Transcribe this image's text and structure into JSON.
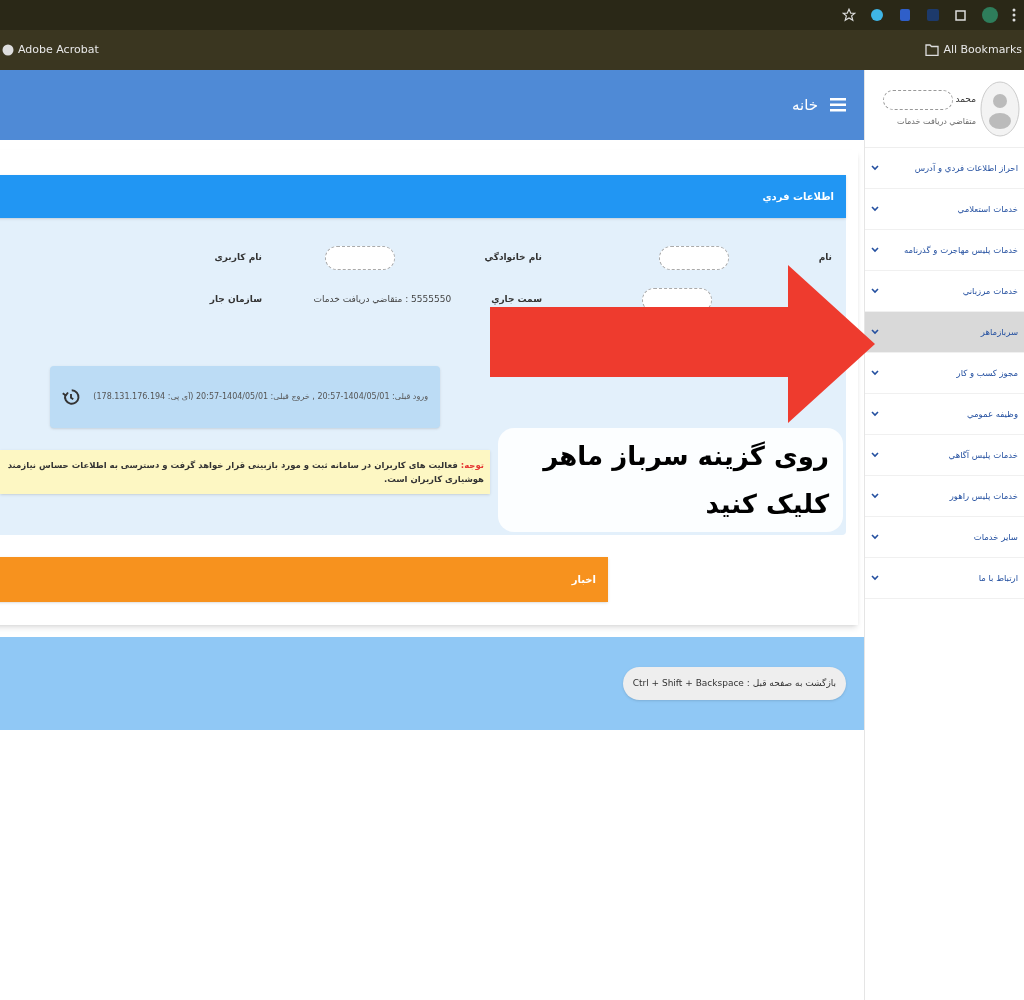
{
  "browser": {
    "bookmarks": [
      {
        "kind": "folder",
        "label": "All Bookmarks"
      },
      {
        "kind": "site",
        "label": "Adobe Acrobat"
      }
    ]
  },
  "header": {
    "title": "خانه"
  },
  "profile": {
    "name": "محمد",
    "name_redacted": true,
    "role": "متقاضي دريافت خدمات"
  },
  "sidebar": {
    "items": [
      {
        "label": "احراز اطلاعات فردي و آدرس",
        "selected": false
      },
      {
        "label": "خدمات استعلامي",
        "selected": false
      },
      {
        "label": "خدمات پليس مهاجرت و گذرنامه",
        "selected": false
      },
      {
        "label": "خدمات مرزباني",
        "selected": false
      },
      {
        "label": "سربازماهر",
        "selected": true
      },
      {
        "label": "مجوز كسب و كار",
        "selected": false
      },
      {
        "label": "وظيفه عمومي",
        "selected": false
      },
      {
        "label": "خدمات پليس آگاهي",
        "selected": false
      },
      {
        "label": "خدمات پليس راهور",
        "selected": false
      },
      {
        "label": "ساير خدمات",
        "selected": false
      },
      {
        "label": "ارتباط با ما",
        "selected": false
      }
    ]
  },
  "personal_info": {
    "title": "اطلاعات فردي",
    "rows": [
      [
        {
          "label": "نام",
          "redacted": true
        },
        {
          "label": "نام خانوادگي",
          "redacted": true
        },
        {
          "label": "نام کاربری"
        }
      ],
      [
        {
          "redacted": true
        },
        {
          "label": "سمت جاري",
          "value": "5555550 : متقاضي دريافت خدمات"
        },
        {
          "label": "سازمان جار"
        }
      ]
    ]
  },
  "last_login": "ورود قبلی: 1404/05/01-20:57 , خروج قبلی: 1404/05/01-20:57 (آی پی: 178.131.176.194)",
  "notice": {
    "label": "توجه:",
    "text": "فعالیت های کاربران در سامانه ثبت و مورد بازبینی قرار خواهد گرفت و دسترسی به اطلاعات حساس نیازمند هوشیاری کاربران است."
  },
  "news": {
    "title": "اخبار"
  },
  "footer": {
    "hint": "Ctrl + Shift + Backspace : بازگشت به صفحه قبل"
  },
  "callout": {
    "lines": [
      "روی گزینه سرباز ماهر",
      "کلیک کنید"
    ]
  }
}
